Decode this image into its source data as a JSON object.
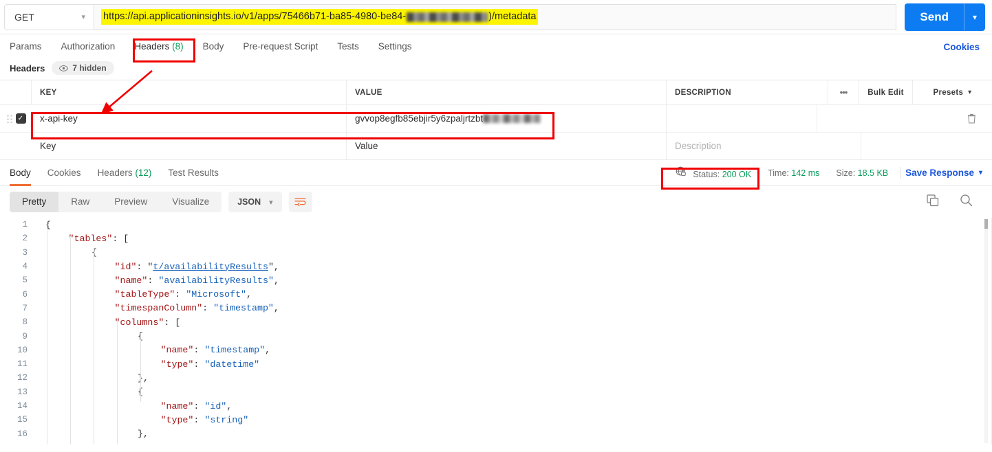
{
  "request": {
    "method": "GET",
    "url_prefix": "https://api.applicationinsights.io/v1/apps/75466b71-ba85-4980-be84-",
    "url_suffix": ")/metadata",
    "send_label": "Send",
    "cookies_link": "Cookies",
    "tabs": [
      {
        "label": "Params",
        "count": "",
        "active": false
      },
      {
        "label": "Authorization",
        "count": "",
        "active": false
      },
      {
        "label": "Headers",
        "count": "(8)",
        "active": true
      },
      {
        "label": "Body",
        "count": "",
        "active": false
      },
      {
        "label": "Pre-request Script",
        "count": "",
        "active": false
      },
      {
        "label": "Tests",
        "count": "",
        "active": false
      },
      {
        "label": "Settings",
        "count": "",
        "active": false
      }
    ]
  },
  "headers_section": {
    "title": "Headers",
    "hidden_label": "7 hidden",
    "columns": {
      "key": "KEY",
      "value": "VALUE",
      "description": "DESCRIPTION",
      "more": "•••",
      "bulk_edit": "Bulk Edit",
      "presets": "Presets"
    },
    "rows": [
      {
        "enabled": true,
        "key": "x-api-key",
        "value": "gvvop8egfb85ebjir5y6zpaljrtzbt",
        "value_redacted": true,
        "description": ""
      }
    ],
    "placeholder_row": {
      "key": "Key",
      "value": "Value",
      "description": "Description"
    }
  },
  "response": {
    "tabs": [
      {
        "label": "Body",
        "count": "",
        "active": true
      },
      {
        "label": "Cookies",
        "count": "",
        "active": false
      },
      {
        "label": "Headers",
        "count": "(12)",
        "active": false
      },
      {
        "label": "Test Results",
        "count": "",
        "active": false
      }
    ],
    "status_label": "Status:",
    "status_value": "200 OK",
    "time_label": "Time:",
    "time_value": "142 ms",
    "size_label": "Size:",
    "size_value": "18.5 KB",
    "save_response": "Save Response",
    "view_modes": [
      {
        "label": "Pretty",
        "active": true
      },
      {
        "label": "Raw",
        "active": false
      },
      {
        "label": "Preview",
        "active": false
      },
      {
        "label": "Visualize",
        "active": false
      }
    ],
    "format": "JSON"
  },
  "code": {
    "lines": [
      {
        "n": "1",
        "indent": 0,
        "tokens": [
          {
            "t": "pun",
            "v": "{"
          }
        ]
      },
      {
        "n": "2",
        "indent": 1,
        "tokens": [
          {
            "t": "key",
            "v": "\"tables\""
          },
          {
            "t": "pun",
            "v": ": ["
          }
        ]
      },
      {
        "n": "3",
        "indent": 2,
        "tokens": [
          {
            "t": "pun",
            "v": "{"
          }
        ]
      },
      {
        "n": "4",
        "indent": 3,
        "tokens": [
          {
            "t": "key",
            "v": "\"id\""
          },
          {
            "t": "pun",
            "v": ": "
          },
          {
            "t": "pun",
            "v": "\""
          },
          {
            "t": "link",
            "v": "t/availabilityResults"
          },
          {
            "t": "pun",
            "v": "\","
          }
        ]
      },
      {
        "n": "5",
        "indent": 3,
        "tokens": [
          {
            "t": "key",
            "v": "\"name\""
          },
          {
            "t": "pun",
            "v": ": "
          },
          {
            "t": "str",
            "v": "\"availabilityResults\""
          },
          {
            "t": "pun",
            "v": ","
          }
        ]
      },
      {
        "n": "6",
        "indent": 3,
        "tokens": [
          {
            "t": "key",
            "v": "\"tableType\""
          },
          {
            "t": "pun",
            "v": ": "
          },
          {
            "t": "str",
            "v": "\"Microsoft\""
          },
          {
            "t": "pun",
            "v": ","
          }
        ]
      },
      {
        "n": "7",
        "indent": 3,
        "tokens": [
          {
            "t": "key",
            "v": "\"timespanColumn\""
          },
          {
            "t": "pun",
            "v": ": "
          },
          {
            "t": "str",
            "v": "\"timestamp\""
          },
          {
            "t": "pun",
            "v": ","
          }
        ]
      },
      {
        "n": "8",
        "indent": 3,
        "tokens": [
          {
            "t": "key",
            "v": "\"columns\""
          },
          {
            "t": "pun",
            "v": ": ["
          }
        ]
      },
      {
        "n": "9",
        "indent": 4,
        "tokens": [
          {
            "t": "pun",
            "v": "{"
          }
        ]
      },
      {
        "n": "10",
        "indent": 5,
        "tokens": [
          {
            "t": "key",
            "v": "\"name\""
          },
          {
            "t": "pun",
            "v": ": "
          },
          {
            "t": "str",
            "v": "\"timestamp\""
          },
          {
            "t": "pun",
            "v": ","
          }
        ]
      },
      {
        "n": "11",
        "indent": 5,
        "tokens": [
          {
            "t": "key",
            "v": "\"type\""
          },
          {
            "t": "pun",
            "v": ": "
          },
          {
            "t": "str",
            "v": "\"datetime\""
          }
        ]
      },
      {
        "n": "12",
        "indent": 4,
        "tokens": [
          {
            "t": "pun",
            "v": "},"
          }
        ]
      },
      {
        "n": "13",
        "indent": 4,
        "tokens": [
          {
            "t": "pun",
            "v": "{"
          }
        ]
      },
      {
        "n": "14",
        "indent": 5,
        "tokens": [
          {
            "t": "key",
            "v": "\"name\""
          },
          {
            "t": "pun",
            "v": ": "
          },
          {
            "t": "str",
            "v": "\"id\""
          },
          {
            "t": "pun",
            "v": ","
          }
        ]
      },
      {
        "n": "15",
        "indent": 5,
        "tokens": [
          {
            "t": "key",
            "v": "\"type\""
          },
          {
            "t": "pun",
            "v": ": "
          },
          {
            "t": "str",
            "v": "\"string\""
          }
        ]
      },
      {
        "n": "16",
        "indent": 4,
        "tokens": [
          {
            "t": "pun",
            "v": "},"
          }
        ]
      }
    ]
  },
  "colors": {
    "accent_blue": "#0d7cf2",
    "link_blue": "#1a56db",
    "success_green": "#0a9c5b",
    "highlight_yellow": "#fdf500",
    "annotation_red": "#f00000",
    "active_tab_orange": "#ef6c32"
  }
}
